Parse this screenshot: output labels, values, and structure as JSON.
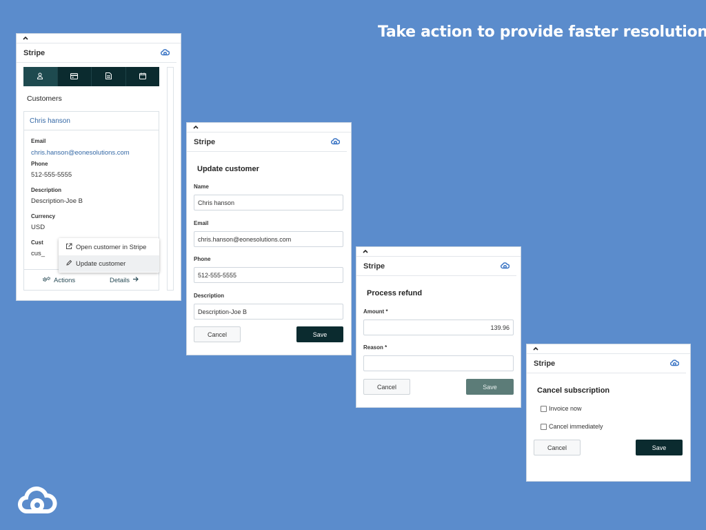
{
  "headline": "Take action to provide faster resolutions",
  "panel_customer": {
    "app_title": "Stripe",
    "section_title": "Customers",
    "tabs": [
      {
        "icon": "user-icon"
      },
      {
        "icon": "card-icon"
      },
      {
        "icon": "document-icon"
      },
      {
        "icon": "calendar-icon"
      }
    ],
    "customer_name": "Chris hanson",
    "email_label": "Email",
    "email_value": "chris.hanson@eonesolutions.com",
    "phone_label": "Phone",
    "phone_value": "512-555-5555",
    "description_label": "Description",
    "description_value": "Description-Joe B",
    "currency_label": "Currency",
    "currency_value": "USD",
    "customer_id_label": "Cust",
    "customer_id_value": "cus_",
    "actions_label": "Actions",
    "details_label": "Details",
    "menu": {
      "open_in_stripe": "Open customer in Stripe",
      "update_customer": "Update customer"
    }
  },
  "panel_update": {
    "app_title": "Stripe",
    "form_title": "Update customer",
    "name_label": "Name",
    "name_value": "Chris hanson",
    "email_label": "Email",
    "email_value": "chris.hanson@eonesolutions.com",
    "phone_label": "Phone",
    "phone_value": "512-555-5555",
    "description_label": "Description",
    "description_value": "Description-Joe B",
    "cancel_label": "Cancel",
    "save_label": "Save"
  },
  "panel_refund": {
    "app_title": "Stripe",
    "form_title": "Process refund",
    "amount_label": "Amount *",
    "amount_value": "139.96",
    "reason_label": "Reason *",
    "reason_value": "",
    "cancel_label": "Cancel",
    "save_label": "Save"
  },
  "panel_subscription": {
    "app_title": "Stripe",
    "form_title": "Cancel subscription",
    "invoice_now_label": "Invoice now",
    "cancel_immediately_label": "Cancel immediately",
    "cancel_label": "Cancel",
    "save_label": "Save"
  },
  "colors": {
    "background": "#5b8ccc",
    "primary_dark": "#0b2b2f",
    "link": "#3468a5",
    "disabled_save": "#5c7c78"
  }
}
